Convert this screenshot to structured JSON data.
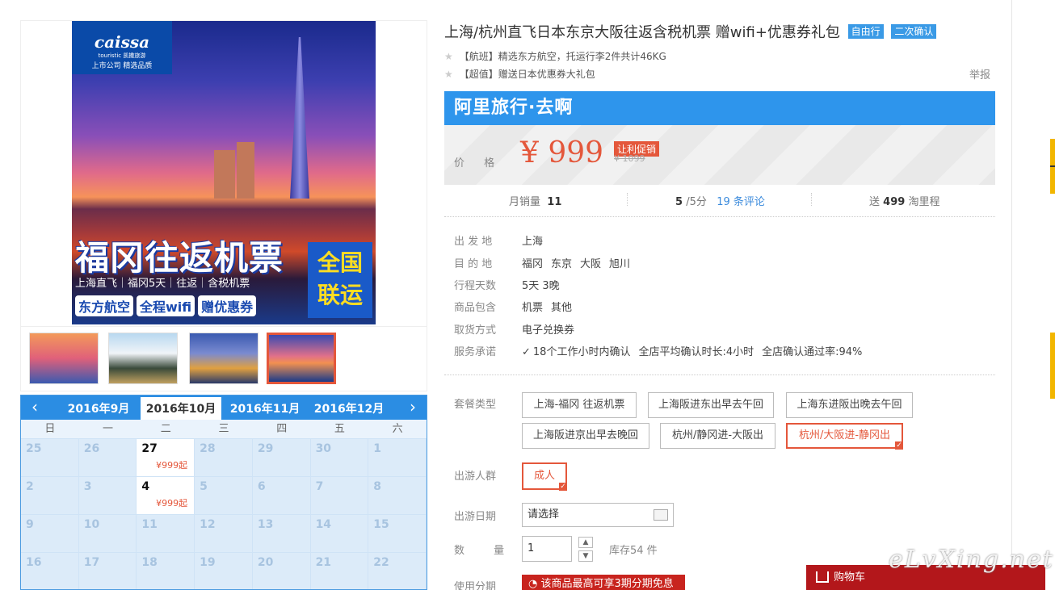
{
  "poster": {
    "logo": "caissa",
    "logo_sub": "touristic 凯撒旅游",
    "logo_tag": "上市公司 精选品质",
    "title": "福冈往返机票",
    "sub": "上海直飞｜福冈5天｜往返｜含税机票",
    "tags": [
      "东方航空",
      "全程wifi",
      "赠优惠券"
    ],
    "nation": [
      "全国",
      "联运"
    ]
  },
  "calendar": {
    "months": [
      "2016年9月",
      "2016年10月",
      "2016年11月",
      "2016年12月"
    ],
    "active_month": "2016年10月",
    "weekdays": [
      "日",
      "一",
      "二",
      "三",
      "四",
      "五",
      "六"
    ],
    "days": [
      {
        "n": "25",
        "cur": false,
        "price": ""
      },
      {
        "n": "26",
        "cur": false,
        "price": ""
      },
      {
        "n": "27",
        "cur": true,
        "price": "¥999起"
      },
      {
        "n": "28",
        "cur": false,
        "price": ""
      },
      {
        "n": "29",
        "cur": false,
        "price": ""
      },
      {
        "n": "30",
        "cur": false,
        "price": ""
      },
      {
        "n": "1",
        "cur": false,
        "price": ""
      },
      {
        "n": "2",
        "cur": false,
        "price": ""
      },
      {
        "n": "3",
        "cur": false,
        "price": ""
      },
      {
        "n": "4",
        "cur": true,
        "price": "¥999起"
      },
      {
        "n": "5",
        "cur": false,
        "price": ""
      },
      {
        "n": "6",
        "cur": false,
        "price": ""
      },
      {
        "n": "7",
        "cur": false,
        "price": ""
      },
      {
        "n": "8",
        "cur": false,
        "price": ""
      },
      {
        "n": "9",
        "cur": false,
        "price": ""
      },
      {
        "n": "10",
        "cur": false,
        "price": ""
      },
      {
        "n": "11",
        "cur": false,
        "price": ""
      },
      {
        "n": "12",
        "cur": false,
        "price": ""
      },
      {
        "n": "13",
        "cur": false,
        "price": ""
      },
      {
        "n": "14",
        "cur": false,
        "price": ""
      },
      {
        "n": "15",
        "cur": false,
        "price": ""
      },
      {
        "n": "16",
        "cur": false,
        "price": ""
      },
      {
        "n": "17",
        "cur": false,
        "price": ""
      },
      {
        "n": "18",
        "cur": false,
        "price": ""
      },
      {
        "n": "19",
        "cur": false,
        "price": ""
      },
      {
        "n": "20",
        "cur": false,
        "price": ""
      },
      {
        "n": "21",
        "cur": false,
        "price": ""
      },
      {
        "n": "22",
        "cur": false,
        "price": ""
      }
    ]
  },
  "product": {
    "title": "上海/杭州直飞日本东京大阪往返含税机票 赠wifi+优惠券礼包",
    "badges": [
      "自由行",
      "二次确认"
    ],
    "features": [
      "【航班】精选东方航空，托运行李2件共计46KG",
      "【超值】赠送日本优惠券大礼包"
    ],
    "report": "举报",
    "platform": "阿里旅行·去啊",
    "price_label": "价 格",
    "price": "¥ 999",
    "promo": "让利促销",
    "old_price": "¥ 1099",
    "sales_label": "月销量",
    "sales": "11",
    "score": "5",
    "score_suffix": "/5分",
    "reviews": "19 条评论",
    "miles_pre": "送",
    "miles": "499",
    "miles_suffix": "淘里程"
  },
  "attributes": [
    {
      "label": "出 发 地",
      "values": [
        "上海"
      ]
    },
    {
      "label": "目 的 地",
      "values": [
        "福冈",
        "东京",
        "大阪",
        "旭川"
      ]
    },
    {
      "label": "行程天数",
      "values": [
        "5天 3晚"
      ]
    },
    {
      "label": "商品包含",
      "values": [
        "机票",
        "其他"
      ]
    },
    {
      "label": "取货方式",
      "values": [
        "电子兑换券"
      ]
    },
    {
      "label": "服务承诺",
      "values": [
        "18个工作小时内确认",
        "全店平均确认时长:4小时",
        "全店确认通过率:94%"
      ]
    }
  ],
  "options": {
    "package_label": "套餐类型",
    "packages": [
      "上海-福冈 往返机票",
      "上海阪进东出早去午回",
      "上海东进阪出晚去午回",
      "上海阪进京出早去晚回",
      "杭州/静冈进-大阪出",
      "杭州/大阪进-静冈出"
    ],
    "selected_package": "杭州/大阪进-静冈出",
    "crowd_label": "出游人群",
    "crowd": "成人",
    "date_label": "出游日期",
    "date_placeholder": "请选择",
    "qty_label": "数 量",
    "qty": "1",
    "stock": "库存54 件",
    "install_label": "使用分期",
    "install": "该商品最高可享3期分期免息"
  },
  "cart": "购物车",
  "watermark": "eLvXing.net"
}
